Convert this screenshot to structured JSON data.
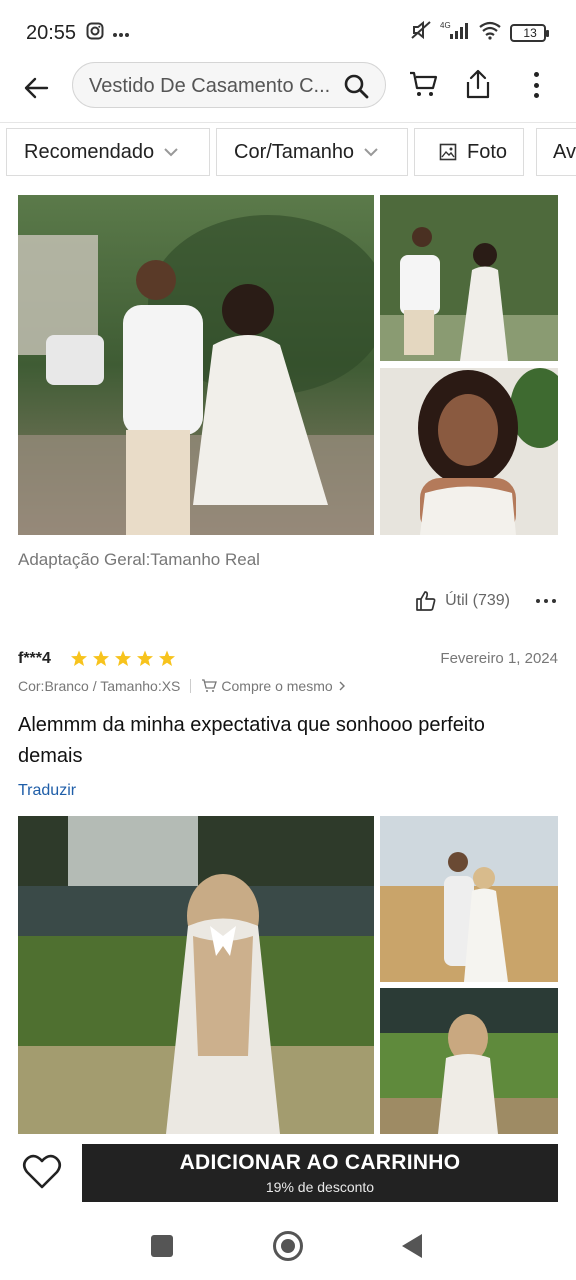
{
  "status_bar": {
    "time": "20:55",
    "network": "4G",
    "battery": "13",
    "battery_level": 0.13,
    "battery_color": "#f4c542"
  },
  "header": {
    "search_text": "Vestido De Casamento C...",
    "icons": [
      "back-arrow-icon",
      "search-icon",
      "cart-icon",
      "share-icon",
      "more-vertical-icon"
    ]
  },
  "filters": [
    {
      "label": "Recomendado"
    },
    {
      "label": "Cor/Tamanho"
    },
    {
      "label": "Foto"
    },
    {
      "label": "Av"
    }
  ],
  "review1": {
    "caption": "Adaptação Geral:Tamanho Real",
    "helpful": "Útil (739)"
  },
  "review2": {
    "user": "f***4",
    "rating": 5,
    "date": "Fevereiro 1, 2024",
    "variant": "Cor:Branco / Tamanho:XS",
    "buy_same": "Compre o mesmo",
    "text": "Alemmm da minha expectativa que sonhooo perfeito demais",
    "translate": "Traduzir"
  },
  "bottom_bar": {
    "add_to_cart": "ADICIONAR AO CARRINHO",
    "discount": "19% de desconto"
  },
  "colors": {
    "star": "#f7c31d",
    "link": "#1f5ea8",
    "button_bg": "#222222"
  }
}
